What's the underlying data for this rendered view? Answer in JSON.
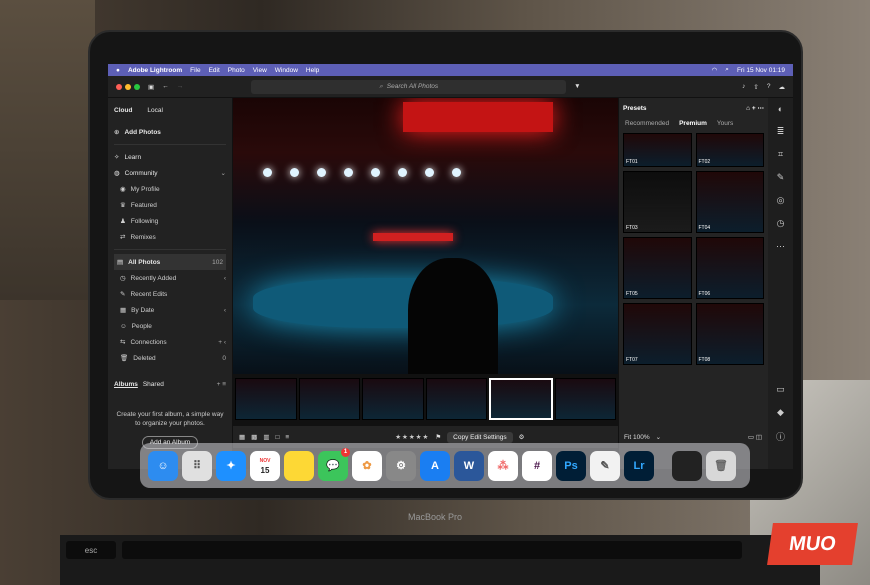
{
  "menubar": {
    "app_name": "Adobe Lightroom",
    "menus": [
      "File",
      "Edit",
      "Photo",
      "View",
      "Window",
      "Help"
    ],
    "datetime": "Fri 15 Nov 01:19"
  },
  "toolbar": {
    "search_placeholder": "Search All Photos"
  },
  "sidebar": {
    "tabs": [
      "Cloud",
      "Local"
    ],
    "add_photos": "Add Photos",
    "learn": "Learn",
    "community": "Community",
    "community_items": [
      "My Profile",
      "Featured",
      "Following",
      "Remixes"
    ],
    "all_photos": "All Photos",
    "all_photos_count": "102",
    "library_items": [
      "Recently Added",
      "Recent Edits",
      "By Date",
      "People",
      "Connections",
      "Deleted"
    ],
    "deleted_count": "0",
    "albums_tabs": [
      "Albums",
      "Shared"
    ],
    "albums_note": "Create your first album, a simple way to organize your photos.",
    "add_album": "Add an Album"
  },
  "bottombar": {
    "stars": "★★★★★",
    "copy_edit": "Copy Edit Settings"
  },
  "presets": {
    "title": "Presets",
    "tabs": [
      "Recommended",
      "Premium",
      "Yours"
    ],
    "items": [
      "FT01",
      "FT02",
      "FT03",
      "FT04",
      "FT05",
      "FT06",
      "FT07",
      "FT08"
    ]
  },
  "viewer": {
    "zoom": "Fit 100%"
  },
  "device": {
    "brand": "MacBook Pro"
  },
  "dock": {
    "calendar_month": "NOV",
    "calendar_day": "15",
    "messages_badge": "1"
  },
  "watermark": "MUO",
  "keyboard": {
    "esc": "esc"
  }
}
